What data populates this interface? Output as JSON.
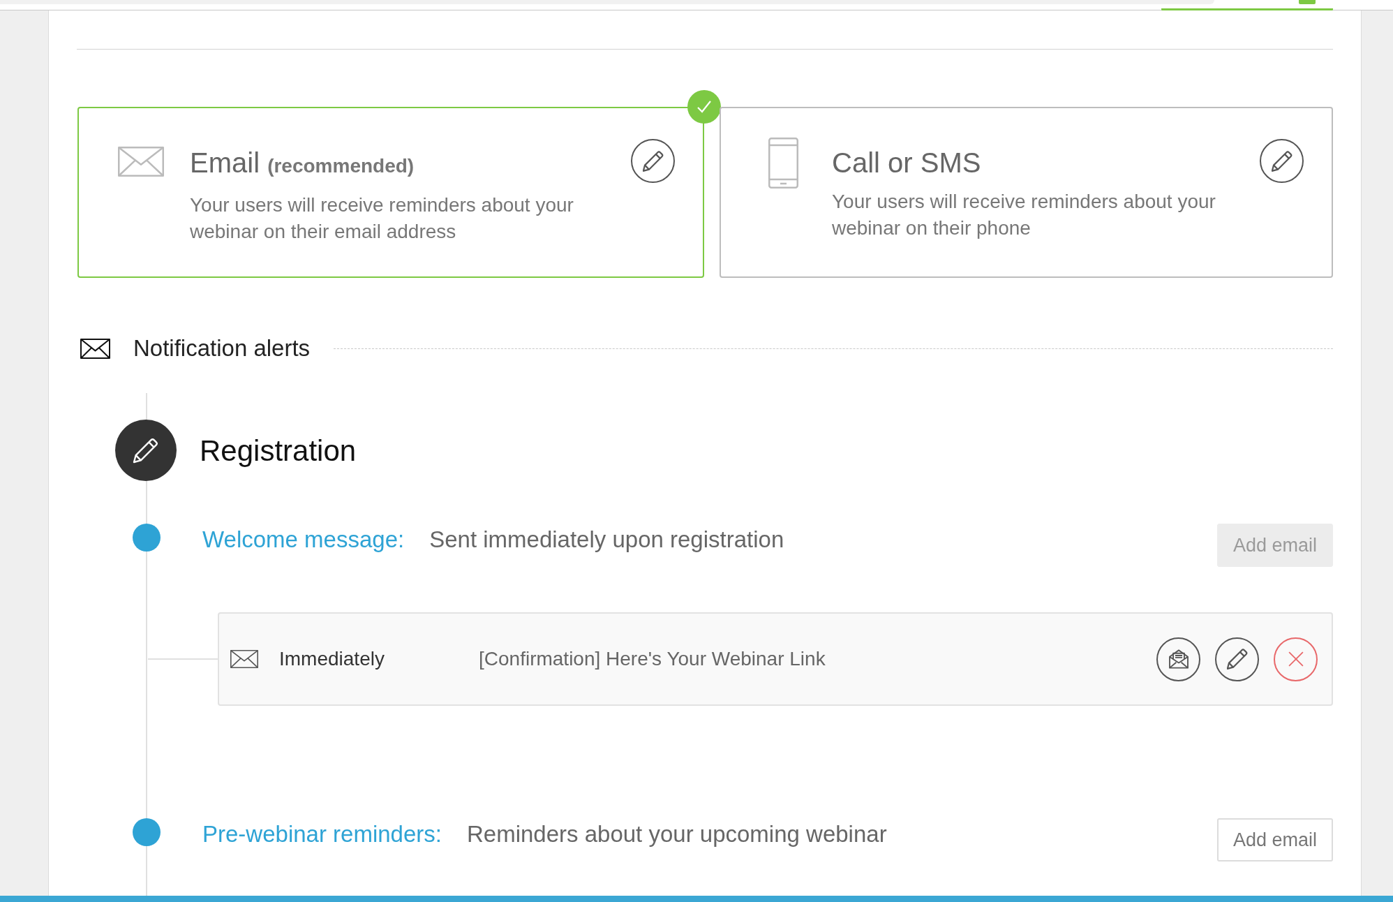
{
  "channels": [
    {
      "kind": "email",
      "title": "Email **(recommended)**",
      "description": "Your users will receive reminders about your webinar on their email address",
      "selected": true
    },
    {
      "kind": "phone",
      "title": "Call or SMS",
      "description": "Your users will receive reminders about your webinar on their phone",
      "selected": false
    }
  ],
  "section": {
    "title": "Notification alerts"
  },
  "timeline": {
    "title": "Registration",
    "groups": [
      {
        "label": "Welcome message:",
        "description": "Sent immediately upon registration",
        "add_button": {
          "label": "Add email",
          "disabled": true
        },
        "emails": [
          {
            "timing": "Immediately",
            "subject": "[Confirmation] Here's Your Webinar Link"
          }
        ]
      },
      {
        "label": "Pre-webinar reminders:",
        "description": "Reminders about your upcoming webinar",
        "add_button": {
          "label": "Add email",
          "disabled": false
        }
      }
    ]
  }
}
